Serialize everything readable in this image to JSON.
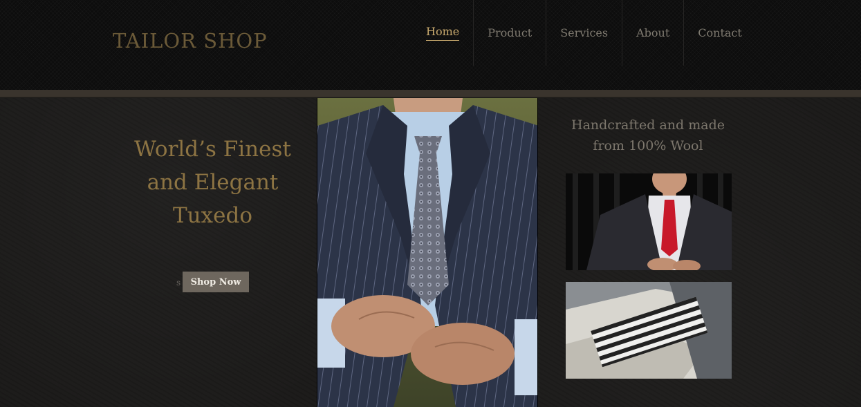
{
  "header": {
    "logo": "TAILOR SHOP",
    "nav": [
      {
        "label": "Home",
        "active": true
      },
      {
        "label": "Product",
        "active": false
      },
      {
        "label": "Services",
        "active": false
      },
      {
        "label": "About",
        "active": false
      },
      {
        "label": "Contact",
        "active": false
      }
    ]
  },
  "hero": {
    "title_lines": [
      "World’s Finest",
      "and Elegant",
      "Tuxedo"
    ],
    "stray_char": "s",
    "cta_label": "Shop Now"
  },
  "sidebar": {
    "tagline_lines": [
      "Handcrafted and made",
      "from 100% Wool"
    ]
  },
  "colors": {
    "accent_gold": "#c9aa6e",
    "title_gold": "#8d7443",
    "button_bg": "#6e675e"
  }
}
